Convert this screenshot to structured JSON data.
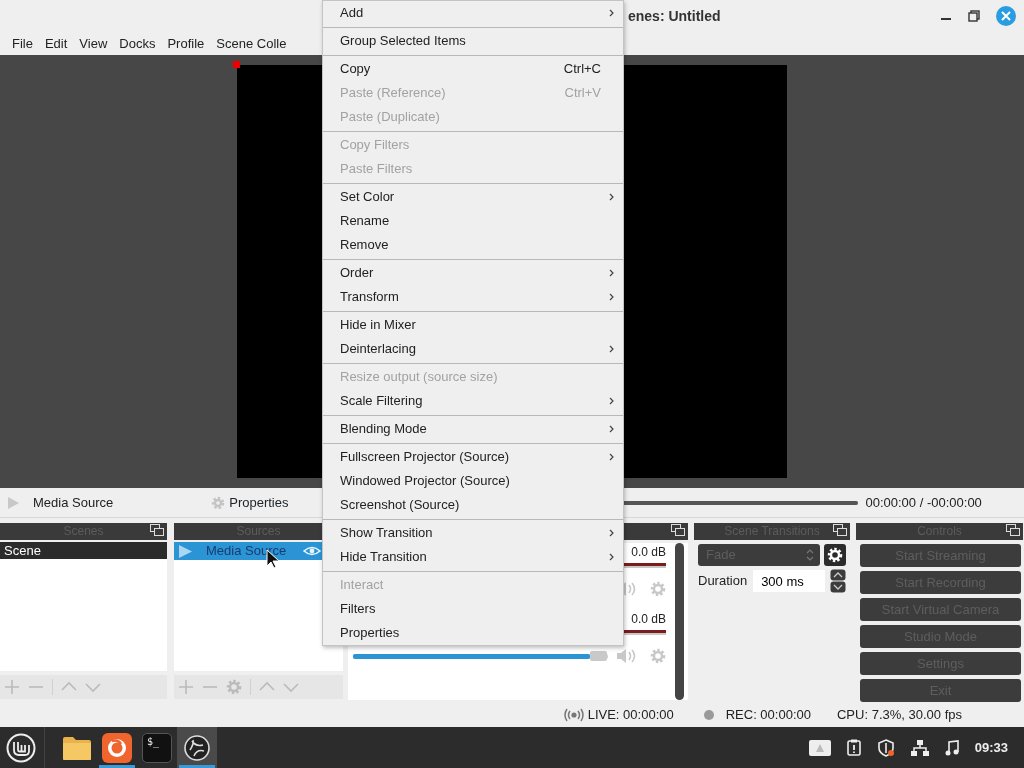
{
  "window": {
    "title_right": "enes: Untitled"
  },
  "menu_bar": [
    "File",
    "Edit",
    "View",
    "Docks",
    "Profile",
    "Scene Colle"
  ],
  "preview": {
    "source_selected": true
  },
  "media_controls": {
    "source": "Media Source",
    "properties_button": "Properties",
    "timeline": {
      "level": 1
    },
    "time": "00:00:00 / -00:00:00"
  },
  "docks": {
    "scenes": {
      "title": "Scenes",
      "items": [
        {
          "label": "Scene",
          "selected": true
        }
      ]
    },
    "sources": {
      "title": "Sources",
      "items": [
        {
          "label": "Media Source",
          "selected": true,
          "visible": true
        }
      ]
    },
    "audio_mixer": {
      "channels": [
        {
          "reading": "0.0 dB"
        },
        {
          "reading": "0.0 dB",
          "level": 0.93
        }
      ]
    },
    "scene_transitions": {
      "title": "Scene Transitions",
      "transition": "Fade",
      "duration_label": "Duration",
      "duration": "300 ms"
    },
    "controls": {
      "title": "Controls",
      "buttons": [
        "Start Streaming",
        "Start Recording",
        "Start Virtual Camera",
        "Studio Mode",
        "Settings",
        "Exit"
      ]
    }
  },
  "context_menu": {
    "items": [
      {
        "kind": "item",
        "label": "Add",
        "submenu": true,
        "disabled": false
      },
      {
        "kind": "separator"
      },
      {
        "kind": "item",
        "label": "Group Selected Items",
        "submenu": false,
        "disabled": false
      },
      {
        "kind": "separator"
      },
      {
        "kind": "item",
        "label": "Copy",
        "shortcut": "Ctrl+C",
        "submenu": false,
        "disabled": false
      },
      {
        "kind": "item",
        "label": "Paste (Reference)",
        "shortcut": "Ctrl+V",
        "submenu": false,
        "disabled": true
      },
      {
        "kind": "item",
        "label": "Paste (Duplicate)",
        "submenu": false,
        "disabled": true
      },
      {
        "kind": "separator"
      },
      {
        "kind": "item",
        "label": "Copy Filters",
        "submenu": false,
        "disabled": true
      },
      {
        "kind": "item",
        "label": "Paste Filters",
        "submenu": false,
        "disabled": true
      },
      {
        "kind": "separator"
      },
      {
        "kind": "item",
        "label": "Set Color",
        "submenu": true,
        "disabled": false
      },
      {
        "kind": "item",
        "label": "Rename",
        "submenu": false,
        "disabled": false
      },
      {
        "kind": "item",
        "label": "Remove",
        "submenu": false,
        "disabled": false
      },
      {
        "kind": "separator"
      },
      {
        "kind": "item",
        "label": "Order",
        "submenu": true,
        "disabled": false
      },
      {
        "kind": "item",
        "label": "Transform",
        "submenu": true,
        "disabled": false
      },
      {
        "kind": "separator"
      },
      {
        "kind": "item",
        "label": "Hide in Mixer",
        "submenu": false,
        "disabled": false
      },
      {
        "kind": "item",
        "label": "Deinterlacing",
        "submenu": true,
        "disabled": false
      },
      {
        "kind": "separator"
      },
      {
        "kind": "item",
        "label": "Resize output (source size)",
        "submenu": false,
        "disabled": true
      },
      {
        "kind": "item",
        "label": "Scale Filtering",
        "submenu": true,
        "disabled": false
      },
      {
        "kind": "separator"
      },
      {
        "kind": "item",
        "label": "Blending Mode",
        "submenu": true,
        "disabled": false
      },
      {
        "kind": "separator"
      },
      {
        "kind": "item",
        "label": "Fullscreen Projector (Source)",
        "submenu": true,
        "disabled": false
      },
      {
        "kind": "item",
        "label": "Windowed Projector (Source)",
        "submenu": false,
        "disabled": false
      },
      {
        "kind": "item",
        "label": "Screenshot (Source)",
        "submenu": false,
        "disabled": false
      },
      {
        "kind": "separator"
      },
      {
        "kind": "item",
        "label": "Show Transition",
        "submenu": true,
        "disabled": false
      },
      {
        "kind": "item",
        "label": "Hide Transition",
        "submenu": true,
        "disabled": false
      },
      {
        "kind": "separator"
      },
      {
        "kind": "item",
        "label": "Interact",
        "submenu": false,
        "disabled": true
      },
      {
        "kind": "item",
        "label": "Filters",
        "submenu": false,
        "disabled": false
      },
      {
        "kind": "item",
        "label": "Properties",
        "submenu": false,
        "disabled": false
      }
    ]
  },
  "status_bar": {
    "live": "LIVE: 00:00:00",
    "rec": "REC: 00:00:00",
    "cpu": "CPU: 7.3%, 30.00 fps"
  },
  "taskbar": {
    "launchers": [
      {
        "kind": "folder",
        "running": false,
        "focused": false
      },
      {
        "kind": "firefox",
        "running": true,
        "focused": false
      },
      {
        "kind": "terminal",
        "glyph": "$_",
        "running": false,
        "focused": false
      },
      {
        "kind": "obs",
        "running": true,
        "focused": true
      }
    ],
    "clock": "09:33"
  }
}
